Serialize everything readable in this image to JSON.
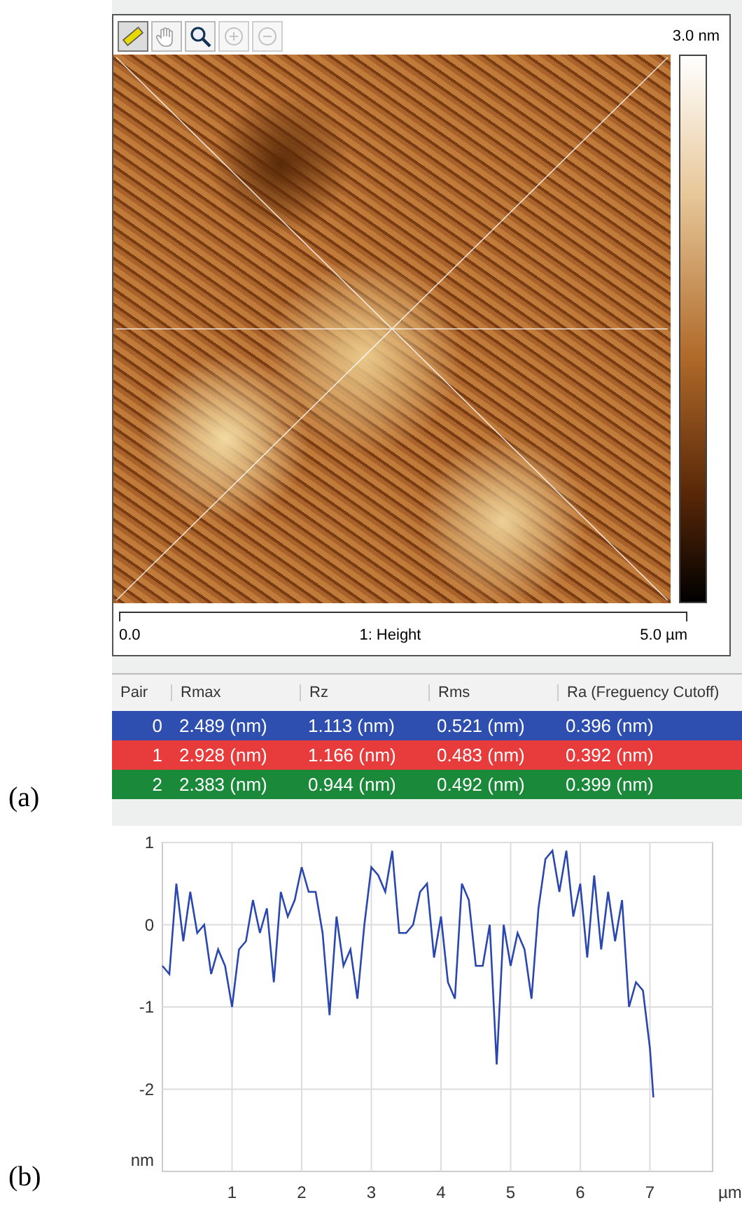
{
  "panel_a": {
    "label": "(a)",
    "toolbar": [
      {
        "kind": "ruler",
        "selected": true,
        "disabled": false
      },
      {
        "kind": "hand",
        "selected": false,
        "disabled": false
      },
      {
        "kind": "magnifier",
        "selected": false,
        "disabled": false
      },
      {
        "kind": "zoom-in",
        "selected": false,
        "disabled": true
      },
      {
        "kind": "zoom-out",
        "selected": false,
        "disabled": true
      }
    ],
    "color_scale_max": "3.0 nm",
    "scale": {
      "start": "0.0",
      "channel": "1: Height",
      "end": "5.0 µm"
    },
    "table": {
      "columns": [
        "Pair",
        "Rmax",
        "Rz",
        "Rms",
        "Ra (Freguency Cutoff)"
      ],
      "rows": [
        {
          "color": "#2f4fb0",
          "cells": [
            "0",
            "2.489 (nm)",
            "1.113 (nm)",
            "0.521 (nm)",
            "0.396 (nm)"
          ]
        },
        {
          "color": "#e83c3c",
          "cells": [
            "1",
            "2.928 (nm)",
            "1.166 (nm)",
            "0.483 (nm)",
            "0.392 (nm)"
          ]
        },
        {
          "color": "#1a8a3a",
          "cells": [
            "2",
            "2.383 (nm)",
            "0.944 (nm)",
            "0.492 (nm)",
            "0.399 (nm)"
          ]
        }
      ]
    }
  },
  "panel_b": {
    "label": "(b)",
    "chart_data": {
      "type": "line",
      "grid": true,
      "xlabel": "µm",
      "ylabel": "nm",
      "xlim": [
        0,
        7.9
      ],
      "ylim": [
        -3,
        1
      ],
      "xticks": [
        1,
        2,
        3,
        4,
        5,
        6,
        7
      ],
      "yticks": [
        -2,
        -1,
        0,
        1
      ],
      "x": [
        0,
        0.1,
        0.2,
        0.3,
        0.4,
        0.5,
        0.6,
        0.7,
        0.8,
        0.9,
        1.0,
        1.1,
        1.2,
        1.3,
        1.4,
        1.5,
        1.6,
        1.7,
        1.8,
        1.9,
        2.0,
        2.1,
        2.2,
        2.3,
        2.4,
        2.5,
        2.6,
        2.7,
        2.8,
        2.9,
        3.0,
        3.1,
        3.2,
        3.3,
        3.4,
        3.5,
        3.6,
        3.7,
        3.8,
        3.9,
        4.0,
        4.1,
        4.2,
        4.3,
        4.4,
        4.5,
        4.6,
        4.7,
        4.8,
        4.9,
        5.0,
        5.1,
        5.2,
        5.3,
        5.4,
        5.5,
        5.6,
        5.7,
        5.8,
        5.9,
        6.0,
        6.1,
        6.2,
        6.3,
        6.4,
        6.5,
        6.6,
        6.7,
        6.8,
        6.9,
        7.0,
        7.05
      ],
      "series": [
        {
          "color": "#2a46b0",
          "values": [
            -0.5,
            -0.6,
            0.5,
            -0.2,
            0.4,
            -0.1,
            0.0,
            -0.6,
            -0.3,
            -0.5,
            -1.0,
            -0.3,
            -0.2,
            0.3,
            -0.1,
            0.2,
            -0.7,
            0.4,
            0.1,
            0.3,
            0.7,
            0.4,
            0.4,
            -0.1,
            -1.1,
            0.1,
            -0.5,
            -0.3,
            -0.9,
            0.0,
            0.7,
            0.6,
            0.4,
            0.9,
            -0.1,
            -0.1,
            0.0,
            0.4,
            0.5,
            -0.4,
            0.1,
            -0.7,
            -0.9,
            0.5,
            0.3,
            -0.5,
            -0.5,
            0.0,
            -1.7,
            0.0,
            -0.5,
            -0.1,
            -0.3,
            -0.9,
            0.2,
            0.8,
            0.9,
            0.4,
            0.9,
            0.1,
            0.5,
            -0.4,
            0.6,
            -0.3,
            0.4,
            -0.2,
            0.3,
            -1.0,
            -0.7,
            -0.8,
            -1.5,
            -2.1
          ]
        }
      ]
    }
  }
}
